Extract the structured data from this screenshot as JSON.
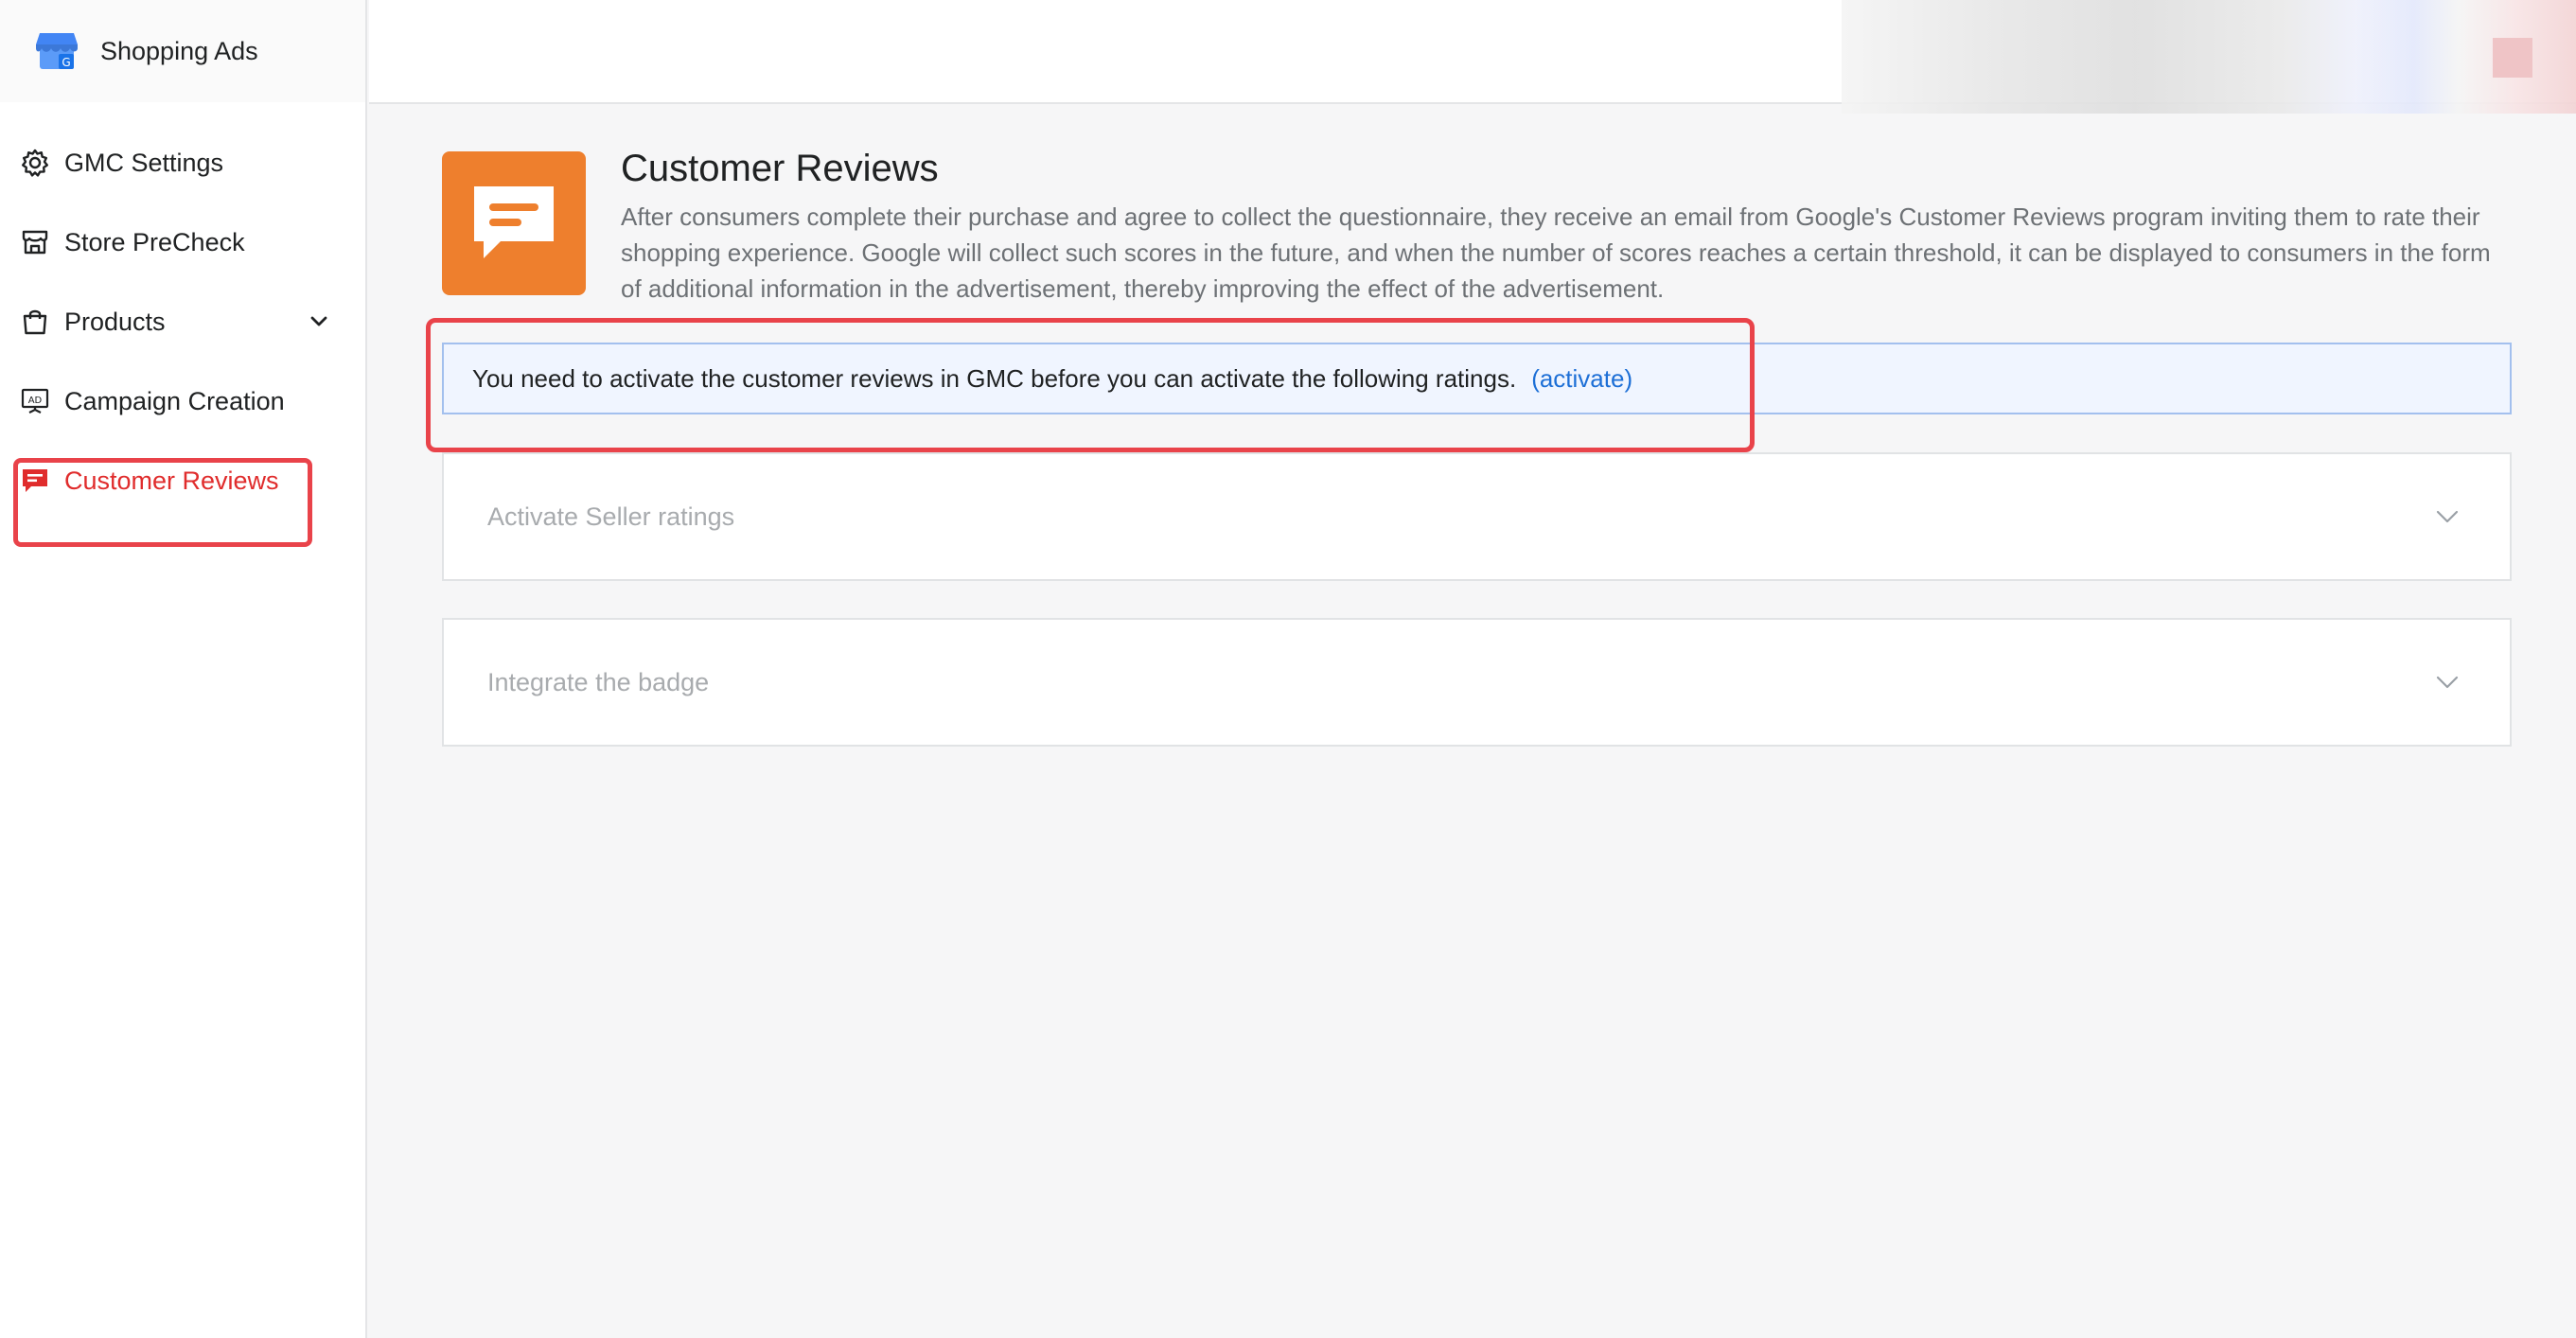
{
  "app": {
    "name": "Shopping Ads"
  },
  "sidebar": {
    "items": [
      {
        "label": "GMC Settings",
        "icon": "gear-icon"
      },
      {
        "label": "Store PreCheck",
        "icon": "store-icon"
      },
      {
        "label": "Products",
        "icon": "shopping-bag-icon",
        "expandable": true
      },
      {
        "label": "Campaign Creation",
        "icon": "ad-display-icon"
      },
      {
        "label": "Customer Reviews",
        "icon": "chat-bubble-icon",
        "active": true
      }
    ]
  },
  "main": {
    "title": "Customer Reviews",
    "description": "After consumers complete their purchase and agree to collect the questionnaire, they receive an email from Google's Customer Reviews program inviting them to rate their shopping experience. Google will collect such scores in the future, and when the number of scores reaches a certain threshold, it can be displayed to consumers in the form of additional information in the advertisement, thereby improving the effect of the advertisement.",
    "notice": {
      "text": "You need to activate the customer reviews in GMC before you can activate the following ratings.",
      "link_label": "(activate)"
    },
    "panels": [
      {
        "label": "Activate Seller ratings"
      },
      {
        "label": "Integrate the badge"
      }
    ]
  },
  "colors": {
    "accent_orange": "#ee7f2d",
    "active_red": "#e02c2c",
    "highlight_red": "#e9434a",
    "link_blue": "#1d6fd6",
    "notice_bg": "#f0f5ff"
  }
}
